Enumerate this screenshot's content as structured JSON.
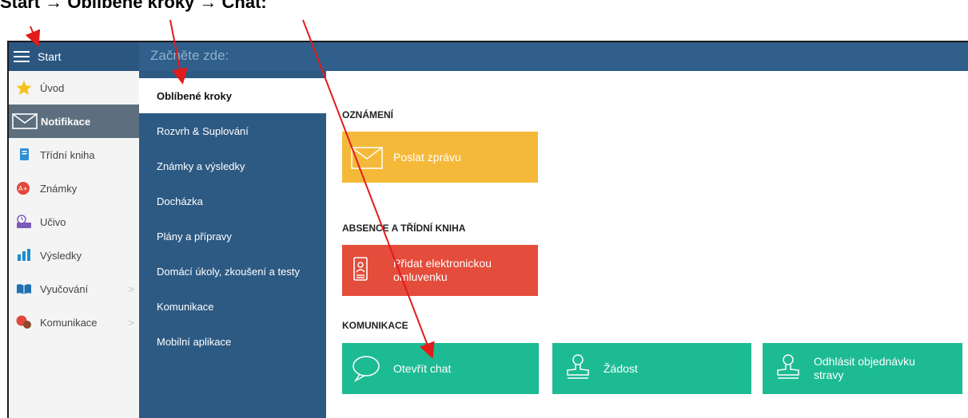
{
  "caption": "Start → Oblíbené kroky → Chat:",
  "topbar": {
    "start_label": "Start",
    "start_here": "Začněte zde:"
  },
  "sidebar": {
    "items": [
      {
        "label": "Úvod",
        "icon": "star-icon"
      },
      {
        "label": "Notifikace",
        "icon": "envelope-icon"
      },
      {
        "label": "Třídní kniha",
        "icon": "class-book-icon"
      },
      {
        "label": "Známky",
        "icon": "grades-icon"
      },
      {
        "label": "Učivo",
        "icon": "curriculum-icon"
      },
      {
        "label": "Výsledky",
        "icon": "bar-chart-icon"
      },
      {
        "label": "Vyučování",
        "icon": "open-book-icon",
        "arrow": ">"
      },
      {
        "label": "Komunikace",
        "icon": "chat-bubbles-icon",
        "arrow": ">"
      }
    ],
    "active_index": 1
  },
  "subnav": {
    "items": [
      "Oblíbené kroky",
      "Rozvrh & Suplování",
      "Známky a výsledky",
      "Docházka",
      "Plány a přípravy",
      "Domácí úkoly, zkoušení a testy",
      "Komunikace",
      "Mobilní aplikace"
    ],
    "selected_index": 0
  },
  "content": {
    "sections": [
      {
        "title": "OZNÁMENÍ",
        "tiles": [
          {
            "label": "Poslat zprávu",
            "color": "#f5b93a",
            "icon": "envelope-icon"
          }
        ]
      },
      {
        "title": "ABSENCE A TŘÍDNÍ KNIHA",
        "tiles": [
          {
            "label": "Přidat elektronickou omluvenku",
            "color": "#e44c3b",
            "icon": "id-badge-icon"
          }
        ]
      },
      {
        "title": "KOMUNIKACE",
        "tiles": [
          {
            "label": "Otevřít chat",
            "color": "#1dbb94",
            "icon": "speech-bubble-icon"
          },
          {
            "label": "Žádost",
            "color": "#1dbb94",
            "icon": "stamp-icon"
          },
          {
            "label": "Odhlásit objednávku stravy",
            "color": "#1dbb94",
            "icon": "stamp-icon"
          }
        ]
      }
    ]
  },
  "colors": {
    "accent": "#2d5a83",
    "annotation_arrow": "#e21b1b"
  }
}
